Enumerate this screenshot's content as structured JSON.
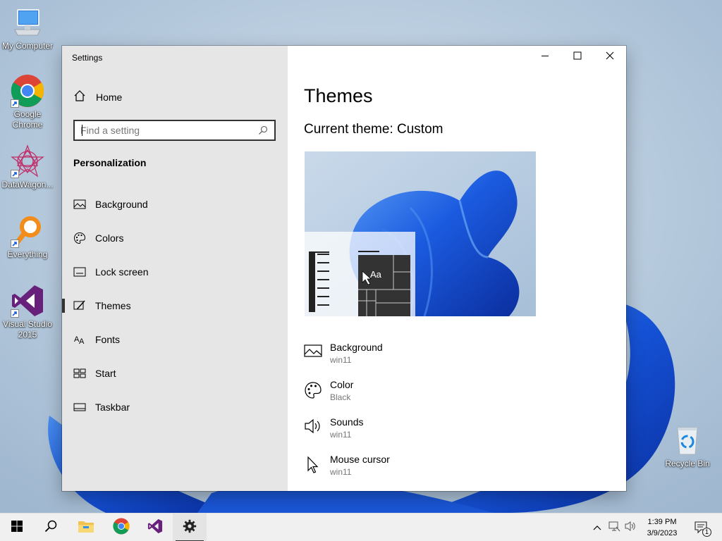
{
  "desktop": {
    "icons": [
      {
        "label": "My Computer"
      },
      {
        "label": "Google Chrome"
      },
      {
        "label": "DataWagon..."
      },
      {
        "label": "Everything"
      },
      {
        "label": "Visual Studio 2015"
      },
      {
        "label": "Recycle Bin"
      }
    ]
  },
  "window": {
    "title": "Settings",
    "controls": {
      "minimize": "minimize-icon",
      "maximize": "maximize-icon",
      "close": "close-icon"
    }
  },
  "sidebar": {
    "home_label": "Home",
    "search": {
      "placeholder": "Find a setting",
      "value": ""
    },
    "section_title": "Personalization",
    "items": [
      {
        "label": "Background",
        "icon": "picture-icon",
        "active": false
      },
      {
        "label": "Colors",
        "icon": "palette-icon",
        "active": false
      },
      {
        "label": "Lock screen",
        "icon": "lock-screen-icon",
        "active": false
      },
      {
        "label": "Themes",
        "icon": "themes-brush-icon",
        "active": true
      },
      {
        "label": "Fonts",
        "icon": "fonts-icon",
        "active": false
      },
      {
        "label": "Start",
        "icon": "start-tiles-icon",
        "active": false
      },
      {
        "label": "Taskbar",
        "icon": "taskbar-icon",
        "active": false
      }
    ]
  },
  "content": {
    "title": "Themes",
    "current_theme": "Current theme: Custom",
    "preview_sample_text": "Aa",
    "properties": [
      {
        "name": "Background",
        "value": "win11",
        "icon": "picture-icon"
      },
      {
        "name": "Color",
        "value": "Black",
        "icon": "palette-icon"
      },
      {
        "name": "Sounds",
        "value": "win11",
        "icon": "speaker-icon"
      },
      {
        "name": "Mouse cursor",
        "value": "win11",
        "icon": "cursor-icon"
      }
    ]
  },
  "taskbar": {
    "apps": [
      "start-icon",
      "search-icon",
      "file-explorer-icon",
      "chrome-icon",
      "visual-studio-icon",
      "settings-gear-icon"
    ],
    "tray": [
      "chevron-up-icon",
      "network-icon",
      "volume-icon"
    ],
    "time": "1:39 PM",
    "date": "3/9/2023",
    "notification_count": "1"
  },
  "colors": {
    "accent_blue": "#1a5fd8",
    "sidebar_bg": "#e6e6e6",
    "taskbar_bg": "#f0f0f0",
    "desktop_bg": "#a9bfd4"
  }
}
